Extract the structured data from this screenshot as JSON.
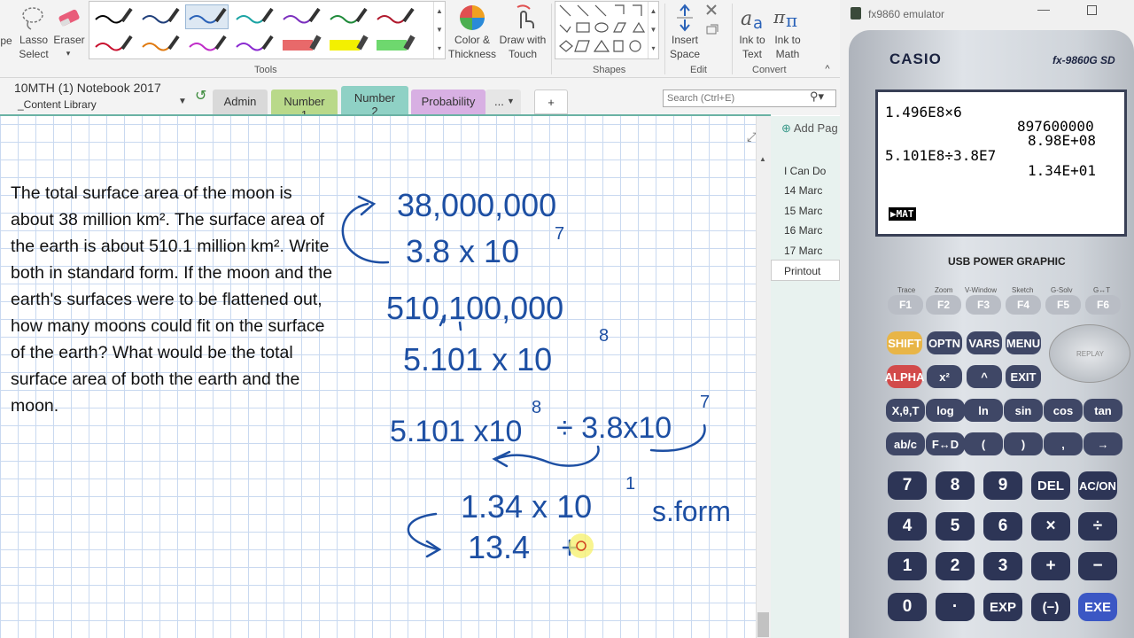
{
  "ribbon": {
    "lasso_label": "Lasso\nSelect",
    "eraser_label": "Eraser",
    "color_label": "Color &\nThickness",
    "draw_touch_label": "Draw with\nTouch",
    "insert_space_label": "Insert\nSpace",
    "ink_text_label": "Ink to\nText",
    "ink_math_label": "Ink to\nMath",
    "groups": {
      "tools": "Tools",
      "shapes": "Shapes",
      "edit": "Edit",
      "convert": "Convert"
    },
    "pen_colors": [
      "#000000",
      "#1f3e7a",
      "#2a62b8",
      "#1aa3a3",
      "#7b2fbe",
      "#1f8a3a",
      "#b0182c",
      "#c8102e",
      "#e07a10",
      "#c02cc8",
      "#8a2ad0",
      "#e8696a",
      "#f3f000",
      "#6ed86e"
    ]
  },
  "notebook": {
    "title": "10MTH (1) Notebook 2017",
    "section": "_Content Library"
  },
  "tabs": [
    {
      "label": "Admin",
      "color": "#d9d9d9"
    },
    {
      "label": "Number 1",
      "color": "#b9d98a"
    },
    {
      "label": "Number 2",
      "color": "#8fd1c5"
    },
    {
      "label": "Probability",
      "color": "#d8b0e3"
    },
    {
      "label": "...",
      "color": "#e6e6e6"
    },
    {
      "label": "+",
      "color": "#ffffff"
    }
  ],
  "search": {
    "placeholder": "Search (Ctrl+E)"
  },
  "add_page": "Add Pag",
  "pages": [
    "I Can Do",
    "14 Marc",
    "15 Marc",
    "16 Marc",
    "17 Marc",
    "Printout"
  ],
  "question": "The total surface area of the moon is about 38 million km². The surface area of the earth is about 510.1 million km². Write both in standard form. If the moon and the earth's surfaces were to be flattened out, how many moons could fit on the surface of the earth? What would be the total surface area of both the earth and the moon.",
  "ink": {
    "l1": "38,000,000",
    "l2": "3.8 x 10",
    "l2e": "7",
    "l3": "510,100,000",
    "l4": "5.101 x 10",
    "l4e": "8",
    "l5a": "5.101 x10",
    "l5ae": "8",
    "l5b": "÷ 3.8x10",
    "l5be": "7",
    "l6": "1.34 x 10",
    "l6e": "1",
    "l6s": "s.form",
    "l7": "13.4",
    "color": "#1d4fa3"
  },
  "emulator": {
    "title": "fx9860 emulator",
    "brand": "CASIO",
    "model": "fx-9860G SD",
    "usb": "USB POWER GRAPHIC",
    "lcd": [
      "1.496E8×6",
      "897600000",
      "8.98E+08",
      "5.101E8÷3.8E7",
      "1.34E+01"
    ],
    "mat": "▶MAT",
    "fkeys": [
      "F1",
      "F2",
      "F3",
      "F4",
      "F5",
      "F6"
    ],
    "fkey_labels": [
      "Trace",
      "Zoom",
      "V-Window",
      "Sketch",
      "G-Solv",
      "G↔T"
    ],
    "row1": [
      "SHIFT",
      "OPTN",
      "VARS",
      "MENU"
    ],
    "row2": [
      "ALPHA",
      "x²",
      "^",
      "EXIT"
    ],
    "row3": [
      "X,θ,T",
      "log",
      "ln",
      "sin",
      "cos",
      "tan"
    ],
    "row4": [
      "ab/c",
      "F↔D",
      "(",
      ")",
      ",",
      "→"
    ],
    "row5": [
      "7",
      "8",
      "9",
      "DEL",
      "AC/ON"
    ],
    "row6": [
      "4",
      "5",
      "6",
      "×",
      "÷"
    ],
    "row7": [
      "1",
      "2",
      "3",
      "+",
      "−"
    ],
    "row8": [
      "0",
      "·",
      "EXP",
      "(−)",
      "EXE"
    ],
    "replay": "REPLAY"
  }
}
